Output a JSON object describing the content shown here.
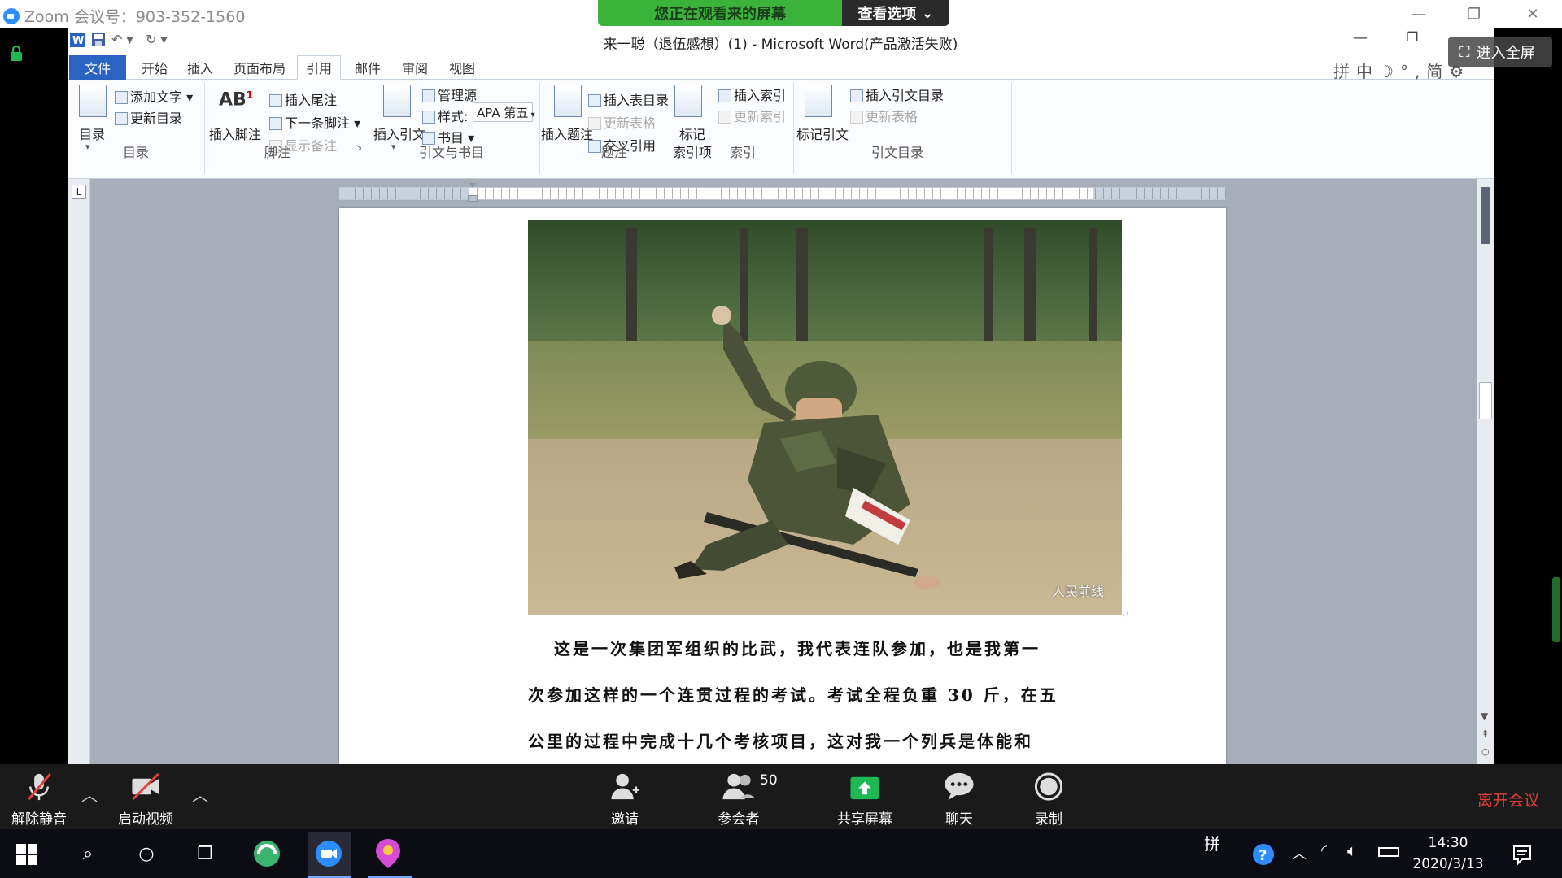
{
  "zoom": {
    "meeting_title": "Zoom 会议号：903-352-1560",
    "banner_text": "您正在观看来的屏幕",
    "view_options_label": "查看选项",
    "fullscreen_label": "进入全屏",
    "bottom": {
      "unmute_label": "解除静音",
      "video_label": "启动视频",
      "invite_label": "邀请",
      "participants_label": "参会者",
      "participants_count": "50",
      "share_label": "共享屏幕",
      "chat_label": "聊天",
      "record_label": "录制",
      "leave_label": "离开会议"
    },
    "accent": "#3bb33b"
  },
  "word": {
    "title": "来一聪（退伍感想）(1) - Microsoft Word(产品激活失败)",
    "tabs": [
      "文件",
      "开始",
      "插入",
      "页面布局",
      "引用",
      "邮件",
      "审阅",
      "视图"
    ],
    "active_tab": "引用",
    "ime_bar": [
      "拼",
      "中",
      "简"
    ],
    "ruler_corner": "L",
    "ribbon": {
      "toc": {
        "toc_label": "目录",
        "add_text": "添加文字",
        "update_toc": "更新目录",
        "group_label": "目录"
      },
      "footnotes": {
        "insert_footnote": "插入脚注",
        "footnote_glyph": "AB",
        "footnote_sup": "1",
        "insert_endnote": "插入尾注",
        "next_footnote": "下一条脚注",
        "show_notes": "显示备注",
        "group_label": "脚注"
      },
      "citations": {
        "insert_citation": "插入引文",
        "manage_sources": "管理源",
        "style_label": "样式:",
        "style_value": "APA 第五",
        "bibliography": "书目",
        "group_label": "引文与书目"
      },
      "captions": {
        "insert_caption": "插入题注",
        "insert_table_of_figures": "插入表目录",
        "update_table": "更新表格",
        "cross_reference": "交叉引用",
        "group_label": "题注"
      },
      "index": {
        "mark_entry_line1": "标记",
        "mark_entry_line2": "索引项",
        "insert_index": "插入索引",
        "update_index": "更新索引",
        "group_label": "索引"
      },
      "toa": {
        "mark_citation": "标记引文",
        "insert_toa": "插入引文目录",
        "update_table": "更新表格",
        "group_label": "引文目录"
      }
    },
    "document": {
      "photo_watermark": "人民前线",
      "paragraph_lines": [
        "这是一次集团军组织的比武，我代表连队参加，也是我第一",
        "次参加这样的一个连贯过程的考试。考试全程负重 30 斤，在五",
        "公里的过程中完成十几个考核项目，这对我一个列兵是体能和"
      ]
    }
  },
  "taskbar": {
    "ime": "拼",
    "time": "14:30",
    "date": "2020/3/13"
  }
}
